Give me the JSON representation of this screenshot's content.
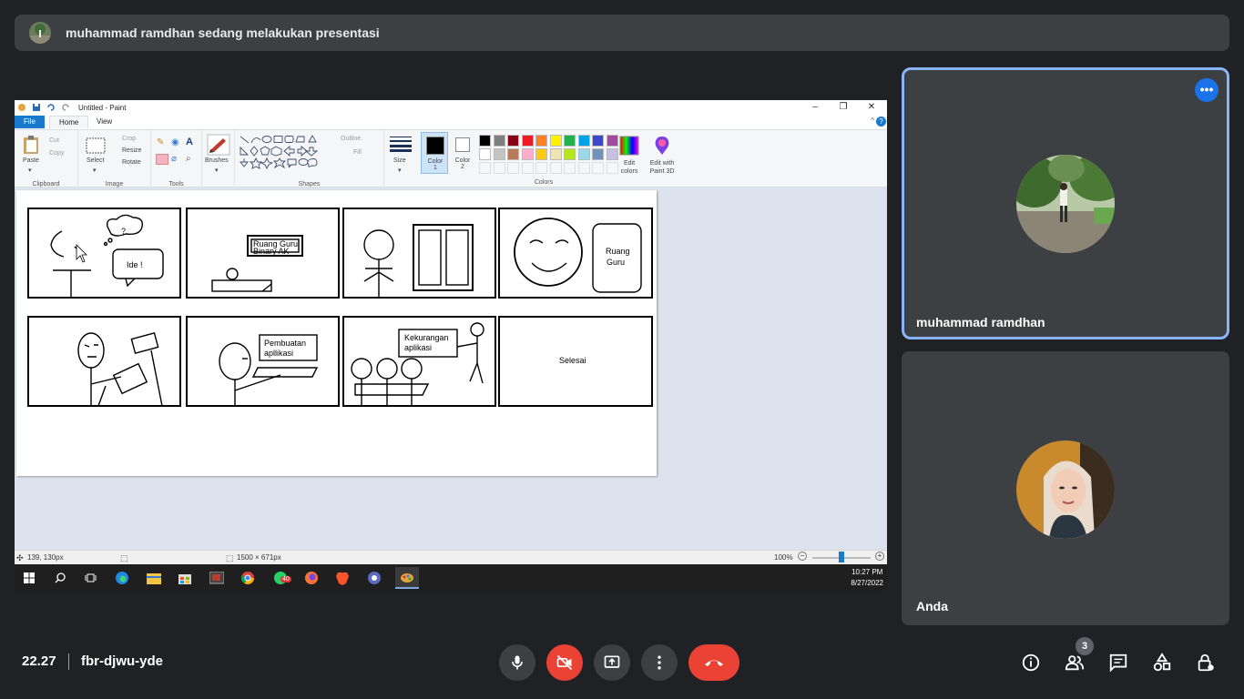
{
  "banner": {
    "text": "muhammad ramdhan sedang melakukan presentasi"
  },
  "paint": {
    "window_title": "Untitled - Paint",
    "tabs": [
      "File",
      "Home",
      "View"
    ],
    "ribbon": {
      "clipboard": {
        "paste": "Paste",
        "cut": "Cut",
        "copy": "Copy",
        "label": "Clipboard"
      },
      "image": {
        "select": "Select",
        "crop": "Crop",
        "resize": "Resize",
        "rotate": "Rotate",
        "label": "Image"
      },
      "tools": {
        "label": "Tools"
      },
      "brushes": "Brushes",
      "shapes": {
        "outline": "Outline",
        "fill": "Fill",
        "label": "Shapes"
      },
      "size": "Size",
      "color1": "Color 1",
      "color2": "Color 2",
      "colors_label": "Colors",
      "edit_colors": "Edit colors",
      "edit_paint3d": "Edit with Paint 3D",
      "palette_row1": [
        "#000000",
        "#7f7f7f",
        "#880015",
        "#ed1c24",
        "#ff7f27",
        "#fff200",
        "#22b14c",
        "#00a2e8",
        "#3f48cc",
        "#a349a4"
      ],
      "palette_row2": [
        "#ffffff",
        "#c3c3c3",
        "#b97a57",
        "#ffaec9",
        "#ffc90e",
        "#efe4b0",
        "#b5e61d",
        "#99d9ea",
        "#7092be",
        "#c8bfe7"
      ]
    },
    "canvas_texts": {
      "question": "?",
      "ide": "Ide !",
      "ruang_guru_1": "Ruang Guru",
      "binary_ak": "Binary AK",
      "ruang": "Ruang",
      "guru": "Guru",
      "pembuatan": "Pembuatan",
      "aplikasi_1": "apllikasi",
      "kekurangan": "Kekurangan",
      "aplikasi_2": "aplikasi",
      "selesai": "Selesai"
    },
    "status": {
      "cursor": "139, 130px",
      "size": "1500 × 671px",
      "zoom": "100%"
    },
    "taskbar": {
      "whatsapp_badge": "40",
      "time": "10:27 PM",
      "date": "8/27/2022"
    }
  },
  "participants": [
    {
      "name": "muhammad ramdhan",
      "more": "•••"
    },
    {
      "name": "Anda"
    }
  ],
  "meeting": {
    "time": "22.27",
    "code": "fbr-djwu-yde",
    "people_count": "3"
  },
  "colors": {
    "accent": "#8ab4f8",
    "danger": "#ea4335",
    "surface": "#3c4043",
    "bg": "#202124"
  }
}
